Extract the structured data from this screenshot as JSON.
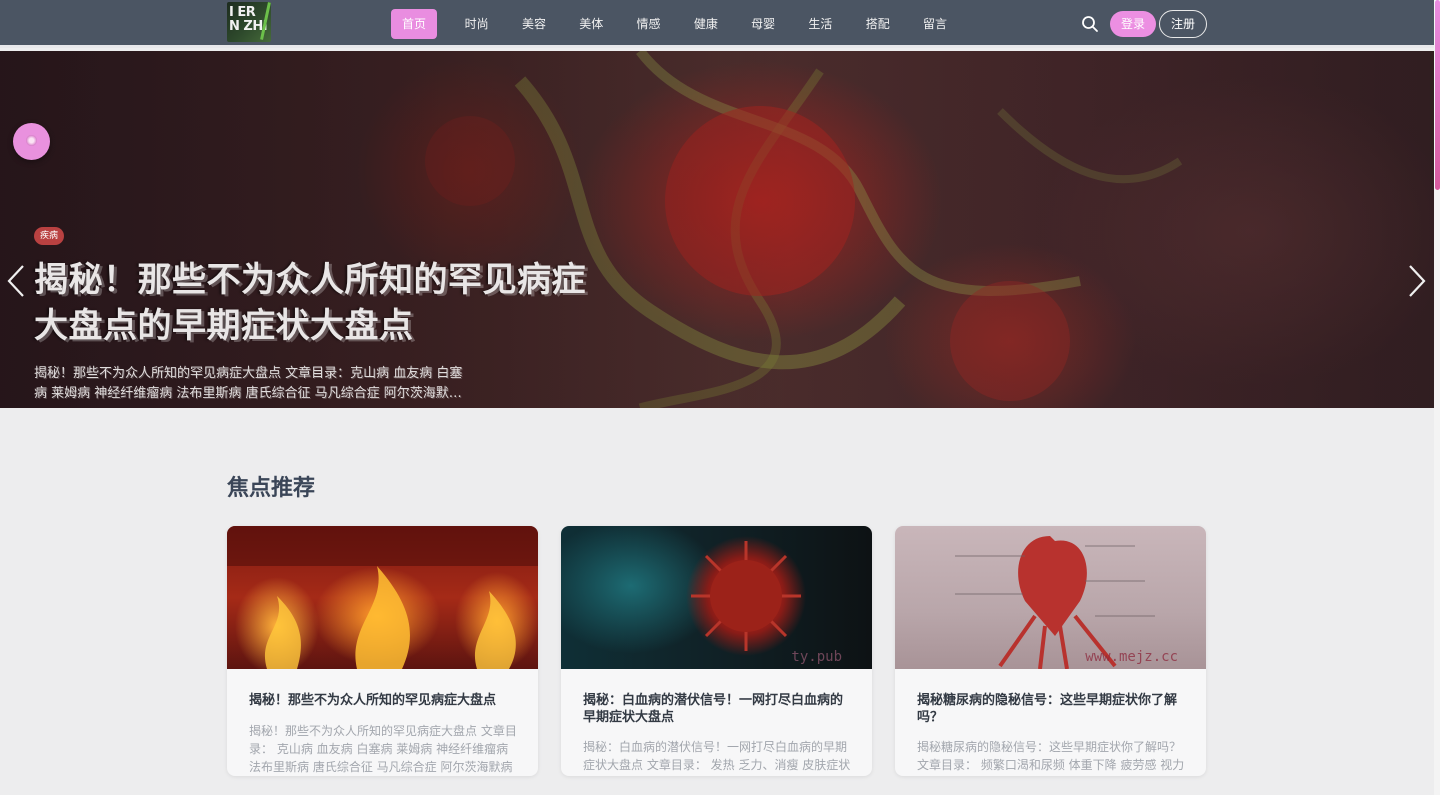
{
  "header": {
    "logo": {
      "line1": "I ER",
      "line2": "N ZHI"
    },
    "nav": [
      "首页",
      "时尚",
      "美容",
      "美体",
      "情感",
      "健康",
      "母婴",
      "生活",
      "搭配",
      "留言"
    ],
    "login_label": "登录",
    "register_label": "注册"
  },
  "hero": {
    "tag": "疾病",
    "title": "揭秘！那些不为众人所知的罕见病症大盘点的早期症状大盘点",
    "description": "揭秘！那些不为众人所知的罕见病症大盘点 文章目录：克山病 血友病 白塞病 莱姆病 神经纤维瘤病 法布里斯病 唐氏综合征 马凡综合症 阿尔茨海默…",
    "dots": 5
  },
  "section": {
    "title": "焦点推荐",
    "cards": [
      {
        "title": "揭秘！那些不为众人所知的罕见病症大盘点",
        "desc": "揭秘！那些不为众人所知的罕见病症大盘点 文章目录： 克山病 血友病 白塞病 莱姆病 神经纤维瘤病 法布里斯病 唐氏综合征 马凡综合症 阿尔茨海默病 唐…"
      },
      {
        "title": "揭秘：白血病的潜伏信号！一网打尽白血病的早期症状大盘点",
        "desc": "揭秘：白血病的潜伏信号！一网打尽白血病的早期症状大盘点 文章目录： 发热 乏力、消瘦 皮肤症状 关节疼痛 淋巴结肿大 脾脏肿大 贫血 出血倾向…",
        "watermark": "ty.pub"
      },
      {
        "title": "揭秘糖尿病的隐秘信号：这些早期症状你了解吗？",
        "desc": "揭秘糖尿病的隐秘信号：这些早期症状你了解吗？ 文章目录： 频繁口渴和尿频 体重下降 疲劳感 视力模糊 伤口愈合缓慢 皮肤瘙痒 手脚麻木…",
        "watermark": "www.mejz.cc"
      }
    ]
  }
}
